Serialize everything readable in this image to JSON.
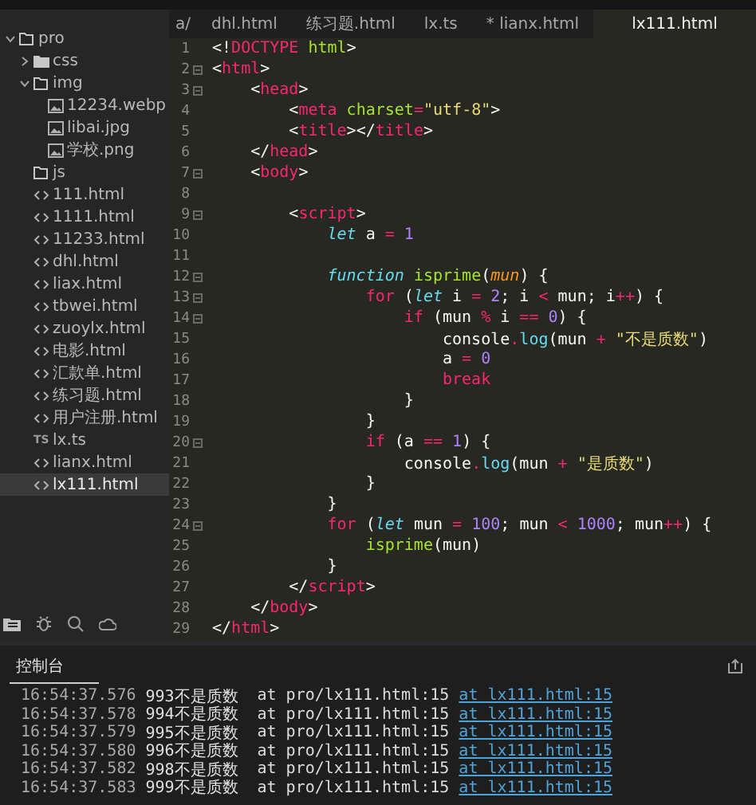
{
  "tabs": [
    {
      "label": "a/",
      "selected": false
    },
    {
      "label": "dhl.html",
      "selected": false
    },
    {
      "label": "练习题.html",
      "selected": false
    },
    {
      "label": "lx.ts",
      "selected": false
    },
    {
      "label": "* lianx.html",
      "selected": false
    },
    {
      "label": "lx111.html",
      "selected": true
    }
  ],
  "sidebar": {
    "tree": [
      {
        "name": "pro",
        "kind": "folder",
        "expanded": true,
        "selected": false,
        "children": [
          {
            "name": "css",
            "kind": "folder",
            "expanded": false,
            "selected": false
          },
          {
            "name": "img",
            "kind": "folder",
            "expanded": true,
            "selected": false,
            "children": [
              {
                "name": "12234.webp",
                "kind": "image",
                "selected": false
              },
              {
                "name": "libai.jpg",
                "kind": "image",
                "selected": false
              },
              {
                "name": "学校.png",
                "kind": "image",
                "selected": false
              }
            ]
          },
          {
            "name": "js",
            "kind": "folder",
            "selected": false
          },
          {
            "name": "111.html",
            "kind": "html",
            "selected": false
          },
          {
            "name": "1111.html",
            "kind": "html",
            "selected": false
          },
          {
            "name": "11233.html",
            "kind": "html",
            "selected": false
          },
          {
            "name": "dhl.html",
            "kind": "html",
            "selected": false
          },
          {
            "name": "liax.html",
            "kind": "html",
            "selected": false
          },
          {
            "name": "tbwei.html",
            "kind": "html",
            "selected": false
          },
          {
            "name": "zuoylx.html",
            "kind": "html",
            "selected": false
          },
          {
            "name": "电影.html",
            "kind": "html",
            "selected": false
          },
          {
            "name": "汇款单.html",
            "kind": "html",
            "selected": false
          },
          {
            "name": "练习题.html",
            "kind": "html",
            "selected": false
          },
          {
            "name": "用户注册.html",
            "kind": "html",
            "selected": false
          },
          {
            "name": "lx.ts",
            "kind": "ts",
            "type_label": "TS",
            "selected": false
          },
          {
            "name": "lianx.html",
            "kind": "html",
            "selected": false
          },
          {
            "name": "lx111.html",
            "kind": "html",
            "selected": true
          }
        ]
      }
    ]
  },
  "editor": {
    "lines": [
      {
        "number": "1",
        "fold": false,
        "tokens": [
          {
            "kind": "punct",
            "text": "<!"
          },
          {
            "kind": "tag",
            "text": "DOCTYPE"
          },
          {
            "kind": "attr",
            "text": " html"
          },
          {
            "kind": "punct",
            "text": ">"
          }
        ]
      },
      {
        "number": "2",
        "fold": true,
        "tokens": [
          {
            "kind": "punct",
            "text": "<"
          },
          {
            "kind": "tag",
            "text": "html"
          },
          {
            "kind": "punct",
            "text": ">"
          }
        ]
      },
      {
        "number": "3",
        "fold": true,
        "tokens": [
          {
            "kind": "punct",
            "text": "    <"
          },
          {
            "kind": "tag",
            "text": "head"
          },
          {
            "kind": "punct",
            "text": ">"
          }
        ]
      },
      {
        "number": "4",
        "fold": false,
        "tokens": [
          {
            "kind": "punct",
            "text": "        <"
          },
          {
            "kind": "tag",
            "text": "meta"
          },
          {
            "kind": "attr",
            "text": " charset"
          },
          {
            "kind": "op",
            "text": "="
          },
          {
            "kind": "string",
            "text": "\"utf-8\""
          },
          {
            "kind": "punct",
            "text": ">"
          }
        ]
      },
      {
        "number": "5",
        "fold": false,
        "tokens": [
          {
            "kind": "punct",
            "text": "        <"
          },
          {
            "kind": "tag",
            "text": "title"
          },
          {
            "kind": "punct",
            "text": "></"
          },
          {
            "kind": "tag",
            "text": "title"
          },
          {
            "kind": "punct",
            "text": ">"
          }
        ]
      },
      {
        "number": "6",
        "fold": false,
        "tokens": [
          {
            "kind": "punct",
            "text": "    </"
          },
          {
            "kind": "tag",
            "text": "head"
          },
          {
            "kind": "punct",
            "text": ">"
          }
        ]
      },
      {
        "number": "7",
        "fold": true,
        "tokens": [
          {
            "kind": "punct",
            "text": "    <"
          },
          {
            "kind": "tag",
            "text": "body"
          },
          {
            "kind": "punct",
            "text": ">"
          }
        ]
      },
      {
        "number": "8",
        "fold": false
      },
      {
        "number": "9",
        "fold": true,
        "tokens": [
          {
            "kind": "punct",
            "text": "        <"
          },
          {
            "kind": "tag",
            "text": "script"
          },
          {
            "kind": "punct",
            "text": ">"
          }
        ]
      },
      {
        "number": "10",
        "fold": false,
        "tokens": [
          {
            "kind": "storage",
            "text": "            let"
          },
          {
            "kind": "punct",
            "text": " a "
          },
          {
            "kind": "op",
            "text": "="
          },
          {
            "kind": "number",
            "text": " 1"
          }
        ]
      },
      {
        "number": "11",
        "fold": false
      },
      {
        "number": "12",
        "fold": true,
        "tokens": [
          {
            "kind": "storage",
            "text": "            function"
          },
          {
            "kind": "func",
            "text": " isprime"
          },
          {
            "kind": "punct",
            "text": "("
          },
          {
            "kind": "param",
            "text": "mun"
          },
          {
            "kind": "punct",
            "text": ") {"
          }
        ]
      },
      {
        "number": "13",
        "fold": true,
        "tokens": [
          {
            "kind": "keyword",
            "text": "                for"
          },
          {
            "kind": "punct",
            "text": " ("
          },
          {
            "kind": "storage",
            "text": "let"
          },
          {
            "kind": "punct",
            "text": " i "
          },
          {
            "kind": "op",
            "text": "="
          },
          {
            "kind": "number",
            "text": " 2"
          },
          {
            "kind": "punct",
            "text": "; i "
          },
          {
            "kind": "op",
            "text": "<"
          },
          {
            "kind": "punct",
            "text": " mun; i"
          },
          {
            "kind": "op",
            "text": "++"
          },
          {
            "kind": "punct",
            "text": ") {"
          }
        ]
      },
      {
        "number": "14",
        "fold": true,
        "tokens": [
          {
            "kind": "keyword",
            "text": "                    if"
          },
          {
            "kind": "punct",
            "text": " (mun "
          },
          {
            "kind": "op",
            "text": "%"
          },
          {
            "kind": "punct",
            "text": " i "
          },
          {
            "kind": "op",
            "text": "=="
          },
          {
            "kind": "number",
            "text": " 0"
          },
          {
            "kind": "punct",
            "text": ") {"
          }
        ]
      },
      {
        "number": "15",
        "fold": false,
        "tokens": [
          {
            "kind": "punct",
            "text": "                        console"
          },
          {
            "kind": "op",
            "text": "."
          },
          {
            "kind": "builtin",
            "text": "log"
          },
          {
            "kind": "punct",
            "text": "(mun "
          },
          {
            "kind": "op",
            "text": "+"
          },
          {
            "kind": "string",
            "text": " \"不是质数\""
          },
          {
            "kind": "punct",
            "text": ")"
          }
        ]
      },
      {
        "number": "16",
        "fold": false,
        "tokens": [
          {
            "kind": "punct",
            "text": "                        a "
          },
          {
            "kind": "op",
            "text": "="
          },
          {
            "kind": "number",
            "text": " 0"
          }
        ]
      },
      {
        "number": "17",
        "fold": false,
        "tokens": [
          {
            "kind": "keyword",
            "text": "                        break"
          }
        ]
      },
      {
        "number": "18",
        "fold": false,
        "tokens": [
          {
            "kind": "punct",
            "text": "                    }"
          }
        ]
      },
      {
        "number": "19",
        "fold": false,
        "tokens": [
          {
            "kind": "punct",
            "text": "                }"
          }
        ]
      },
      {
        "number": "20",
        "fold": true,
        "tokens": [
          {
            "kind": "keyword",
            "text": "                if"
          },
          {
            "kind": "punct",
            "text": " (a "
          },
          {
            "kind": "op",
            "text": "=="
          },
          {
            "kind": "number",
            "text": " 1"
          },
          {
            "kind": "punct",
            "text": ") {"
          }
        ]
      },
      {
        "number": "21",
        "fold": false,
        "tokens": [
          {
            "kind": "punct",
            "text": "                    console"
          },
          {
            "kind": "op",
            "text": "."
          },
          {
            "kind": "builtin",
            "text": "log"
          },
          {
            "kind": "punct",
            "text": "(mun "
          },
          {
            "kind": "op",
            "text": "+"
          },
          {
            "kind": "string",
            "text": " \"是质数\""
          },
          {
            "kind": "punct",
            "text": ")"
          }
        ]
      },
      {
        "number": "22",
        "fold": false,
        "tokens": [
          {
            "kind": "punct",
            "text": "                }"
          }
        ]
      },
      {
        "number": "23",
        "fold": false,
        "tokens": [
          {
            "kind": "punct",
            "text": "            }"
          }
        ]
      },
      {
        "number": "24",
        "fold": true,
        "tokens": [
          {
            "kind": "keyword",
            "text": "            for"
          },
          {
            "kind": "punct",
            "text": " ("
          },
          {
            "kind": "storage",
            "text": "let"
          },
          {
            "kind": "punct",
            "text": " mun "
          },
          {
            "kind": "op",
            "text": "="
          },
          {
            "kind": "number",
            "text": " 100"
          },
          {
            "kind": "punct",
            "text": "; mun "
          },
          {
            "kind": "op",
            "text": "<"
          },
          {
            "kind": "number",
            "text": " 1000"
          },
          {
            "kind": "punct",
            "text": "; mun"
          },
          {
            "kind": "op",
            "text": "++"
          },
          {
            "kind": "punct",
            "text": ") {"
          }
        ]
      },
      {
        "number": "25",
        "fold": false,
        "tokens": [
          {
            "kind": "func",
            "text": "                isprime"
          },
          {
            "kind": "punct",
            "text": "(mun)"
          }
        ]
      },
      {
        "number": "26",
        "fold": false,
        "tokens": [
          {
            "kind": "punct",
            "text": "            }"
          }
        ]
      },
      {
        "number": "27",
        "fold": false,
        "tokens": [
          {
            "kind": "punct",
            "text": "        </"
          },
          {
            "kind": "tag",
            "text": "script"
          },
          {
            "kind": "punct",
            "text": ">"
          }
        ]
      },
      {
        "number": "28",
        "fold": false,
        "tokens": [
          {
            "kind": "punct",
            "text": "    </"
          },
          {
            "kind": "tag",
            "text": "body"
          },
          {
            "kind": "punct",
            "text": ">"
          }
        ]
      },
      {
        "number": "29",
        "fold": false,
        "tokens": [
          {
            "kind": "punct",
            "text": "</"
          },
          {
            "kind": "tag",
            "text": "html"
          },
          {
            "kind": "punct",
            "text": ">"
          }
        ]
      }
    ]
  },
  "console": {
    "tab": {
      "label": "控制台",
      "selected": true
    },
    "rows": [
      {
        "time": "16:54:37.576",
        "message": "993不是质数",
        "source": "at pro/lx111.html:15",
        "link": "at lx111.html:15"
      },
      {
        "time": "16:54:37.578",
        "message": "994不是质数",
        "source": "at pro/lx111.html:15",
        "link": "at lx111.html:15"
      },
      {
        "time": "16:54:37.579",
        "message": "995不是质数",
        "source": "at pro/lx111.html:15",
        "link": "at lx111.html:15"
      },
      {
        "time": "16:54:37.580",
        "message": "996不是质数",
        "source": "at pro/lx111.html:15",
        "link": "at lx111.html:15"
      },
      {
        "time": "16:54:37.582",
        "message": "998不是质数",
        "source": "at pro/lx111.html:15",
        "link": "at lx111.html:15"
      },
      {
        "time": "16:54:37.583",
        "message": "999不是质数",
        "source": "at pro/lx111.html:15",
        "link": "at lx111.html:15"
      }
    ]
  }
}
